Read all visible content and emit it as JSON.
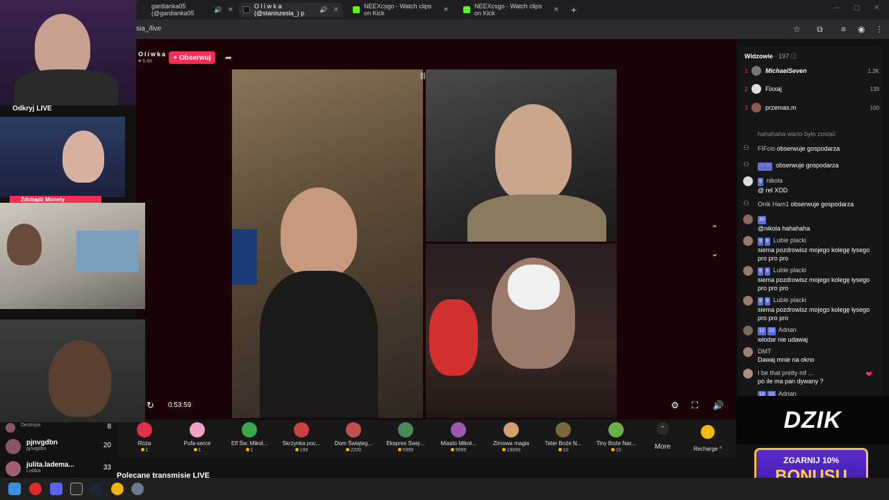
{
  "browser": {
    "tabs": [
      {
        "title": "gardianka05 (@gardianka05",
        "fav_color": "#222222"
      },
      {
        "title": "O l i w k a (@staniszesia_) p",
        "fav_color": "#111111"
      },
      {
        "title": "NEEXcsgo - Watch clips on Kick",
        "fav_color": "#53fc18"
      },
      {
        "title": "NEEXcsgo - Watch clips on Kick",
        "fav_color": "#53fc18"
      }
    ],
    "url": "sia_/live",
    "new_tab_glyph": "+"
  },
  "stream": {
    "host_name": "Oliwka",
    "host_likes": "6.4K",
    "follow_label": "+ Obserwuj",
    "elapsed": "0:53:59"
  },
  "gifts": [
    {
      "name": "Róża",
      "price": "1",
      "color": "#e0304a"
    },
    {
      "name": "Pufa-serce",
      "price": "1",
      "color": "#f2a0c8"
    },
    {
      "name": "Elf Św. Mikoł...",
      "price": "1",
      "color": "#3aa84a"
    },
    {
      "name": "Skrzynka poc...",
      "price": "199",
      "color": "#d04040"
    },
    {
      "name": "Dom Świąteg...",
      "price": "2200",
      "color": "#c05050"
    },
    {
      "name": "Ekspres Świę...",
      "price": "5999",
      "color": "#4a8a5a"
    },
    {
      "name": "Miasto Mikoł...",
      "price": "9999",
      "color": "#9a5ab0"
    },
    {
      "name": "Zimowa magia",
      "price": "19999",
      "color": "#d0a070"
    },
    {
      "name": "Tater Boże N...",
      "price": "10",
      "color": "#7a6a3a"
    },
    {
      "name": "Tiny Boże Nar...",
      "price": "10",
      "color": "#6ab04a"
    }
  ],
  "more_label": "More",
  "recharge_label": "Recharge ^",
  "recommended_title": "Polecane transmisje LIVE",
  "chat": {
    "viewers_label": "Widzowie",
    "viewers_count": "· 197",
    "top_viewers": [
      {
        "rank": "1",
        "name": "MichaelSeven",
        "score": "1.2K"
      },
      {
        "rank": "2",
        "name": "Fixxaj",
        "score": "139"
      },
      {
        "rank": "3",
        "name": "przemas.m",
        "score": "100"
      }
    ],
    "messages": [
      {
        "user": "hahahaha warto było zostać",
        "badges": [],
        "text": ""
      },
      {
        "user": "FIFcio",
        "badges": [],
        "text": "obserwuje gospodarza"
      },
      {
        "user": "",
        "badges": [],
        "text": "obserwuje gospodarza"
      },
      {
        "user": "nikola",
        "badges": [
          "5"
        ],
        "text": "@ rel XDD"
      },
      {
        "user": "Onik Ham1",
        "badges": [],
        "text": "obserwuje gospodarza"
      },
      {
        "user": "",
        "badges": [
          "20"
        ],
        "text": "@nikola hahahaha"
      },
      {
        "user": "Lubie placki",
        "badges": [
          "9",
          "9"
        ],
        "text": "siema pozdrowisz mojego kolegę łysego pro pro pro"
      },
      {
        "user": "Lubie placki",
        "badges": [
          "9",
          "9"
        ],
        "text": "siema pozdrowisz mojego kolegę łysego pro pro pro"
      },
      {
        "user": "Lubie placki",
        "badges": [
          "9",
          "9"
        ],
        "text": "siema pozdrowisz mojego kolegę łysego pro pro pro"
      },
      {
        "user": "Adrian",
        "badges": [
          "10",
          "10"
        ],
        "text": "wlodar nie udawaj"
      },
      {
        "user": "DMT",
        "badges": [],
        "text": "Dawaj mnie na okno"
      },
      {
        "user": "I be that pretty mf ...",
        "badges": [],
        "text": "po ile ma pan dywany ?"
      },
      {
        "user": "Adrian",
        "badges": [
          "10",
          "10"
        ],
        "text": ""
      }
    ]
  },
  "ad": {
    "logo": "DZIK",
    "line1": "ZGARNIJ 10%",
    "line2": "BONUSU"
  },
  "left_panel": {
    "odkryj": "Odkryj LIVE",
    "zdobadz": "Zdobądź Monety",
    "users": [
      {
        "name": "Destroya",
        "sub": "",
        "num": "8"
      },
      {
        "name": "pjnvgdbn",
        "sub": "pjnvgdbn",
        "num": "20"
      },
      {
        "name": "julita.ladema...",
        "sub": "Lolitka",
        "num": "33"
      }
    ]
  }
}
